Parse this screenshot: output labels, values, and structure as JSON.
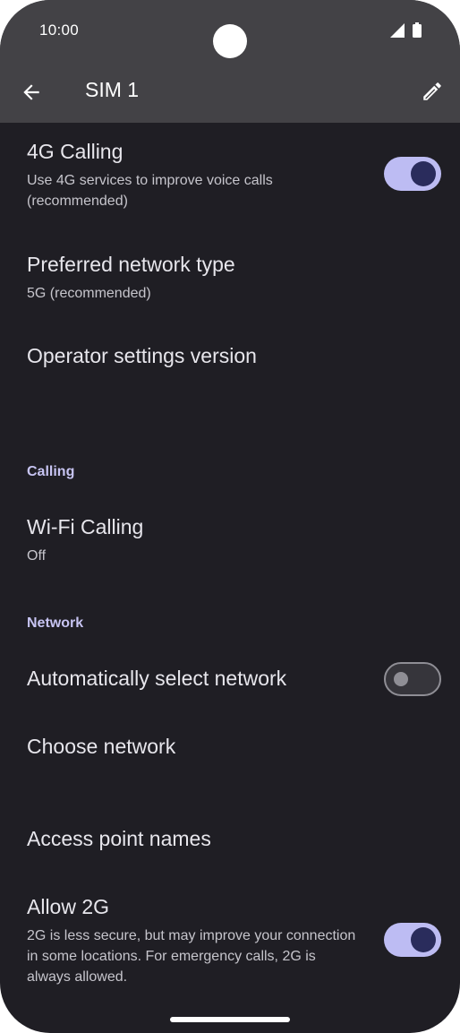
{
  "status_bar": {
    "time": "10:00",
    "icons": [
      "signal-icon",
      "battery-icon"
    ]
  },
  "app_bar": {
    "title": "SIM 1",
    "back_icon": "back-arrow-icon",
    "edit_icon": "pencil-icon"
  },
  "rows": {
    "calling_4g": {
      "title": "4G Calling",
      "subtitle": "Use 4G services to improve voice calls (recommended)",
      "enabled": true
    },
    "network_type": {
      "title": "Preferred network type",
      "subtitle": "5G (recommended)"
    },
    "operator_version": {
      "title": "Operator settings version"
    },
    "wifi_calling": {
      "title": "Wi-Fi Calling",
      "subtitle": "Off"
    },
    "auto_select": {
      "title": "Automatically select network",
      "enabled": false
    },
    "choose_network": {
      "title": "Choose network"
    },
    "apn": {
      "title": "Access point names"
    },
    "allow_2g": {
      "title": "Allow 2G",
      "subtitle": "2G is less secure, but may improve your connection in some locations. For emergency calls, 2G is always allowed.",
      "enabled": true
    }
  },
  "sections": {
    "calling": "Calling",
    "network": "Network"
  },
  "colors": {
    "background": "#1f1e24",
    "app_bar": "#434246",
    "accent": "#bdbcf3",
    "toggle_knob_on": "#2a2c5c",
    "section_header": "#c7c4f2"
  }
}
